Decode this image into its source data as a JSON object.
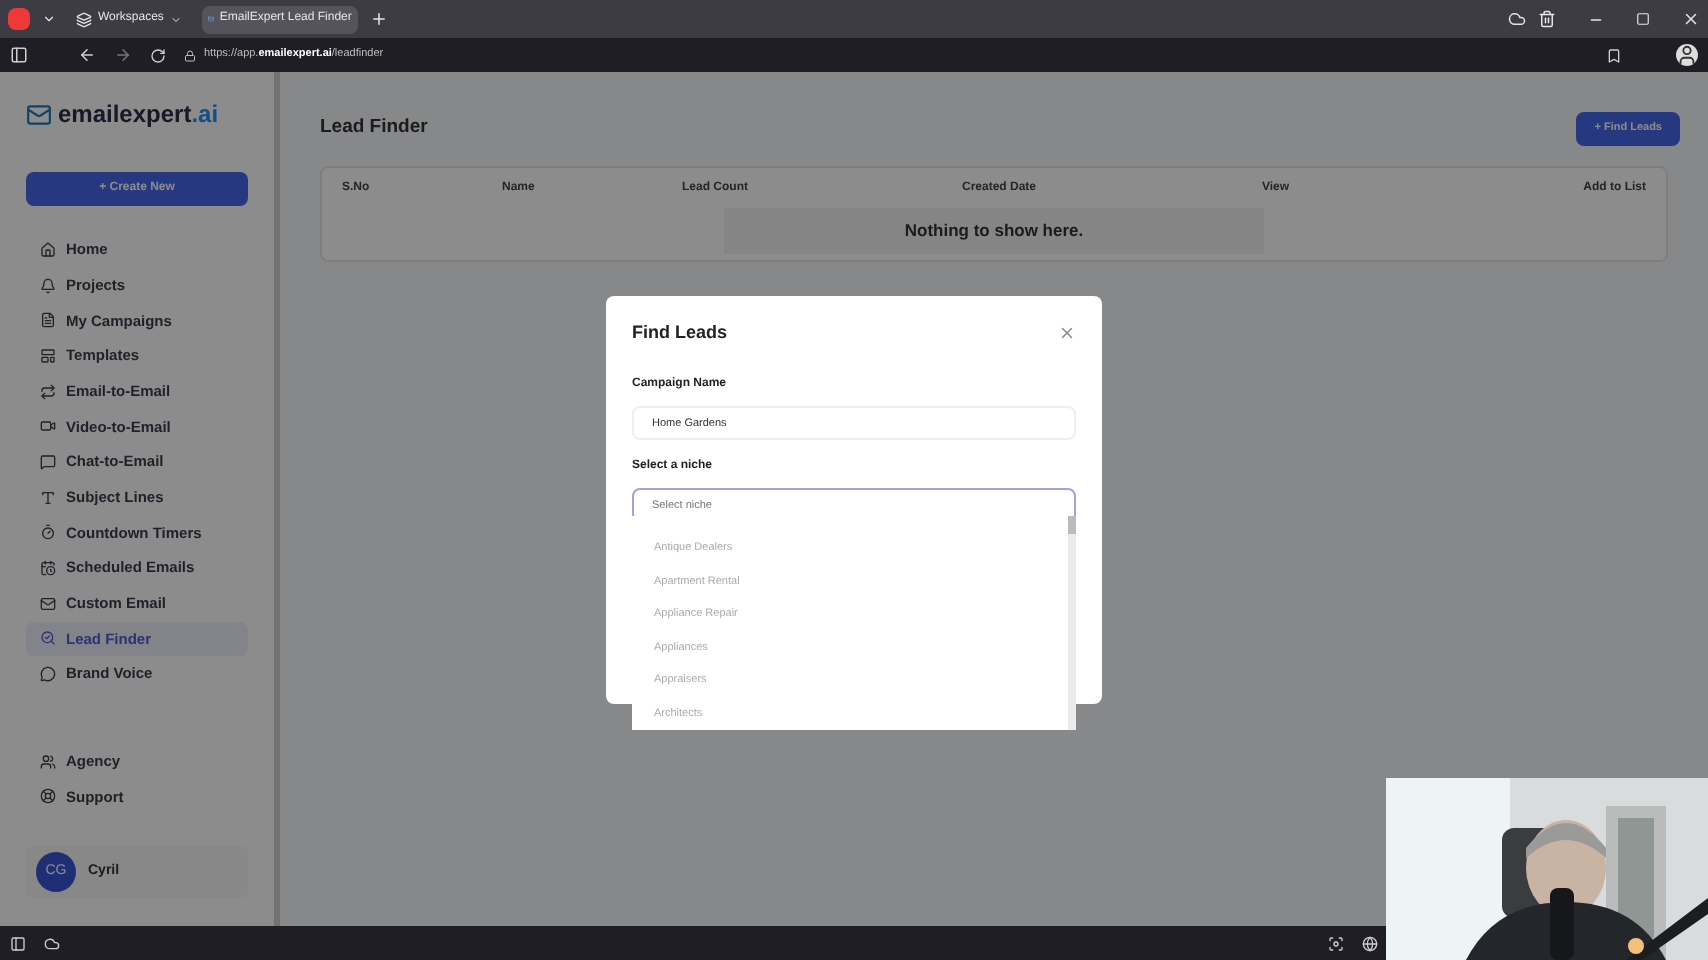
{
  "browser": {
    "workspaces": "Workspaces",
    "tab_title": "EmailExpert Lead Finder",
    "url_prefix": "https://app.",
    "url_domain": "emailexpert.ai",
    "url_path": "/leadfinder"
  },
  "sidebar": {
    "logo_main": "emailexpert",
    "logo_suffix": ".ai",
    "create_button": "+ Create New",
    "items": [
      {
        "label": "Home",
        "selected": false
      },
      {
        "label": "Projects",
        "selected": false
      },
      {
        "label": "My Campaigns",
        "selected": false
      },
      {
        "label": "Templates",
        "selected": false
      },
      {
        "label": "Email-to-Email",
        "selected": false
      },
      {
        "label": "Video-to-Email",
        "selected": false
      },
      {
        "label": "Chat-to-Email",
        "selected": false
      },
      {
        "label": "Subject Lines",
        "selected": false
      },
      {
        "label": "Countdown Timers",
        "selected": false
      },
      {
        "label": "Scheduled Emails",
        "selected": false
      },
      {
        "label": "Custom Email",
        "selected": false
      },
      {
        "label": "Lead Finder",
        "selected": true
      },
      {
        "label": "Brand Voice",
        "selected": false
      }
    ],
    "bottom_items": [
      {
        "label": "Agency",
        "selected": false
      },
      {
        "label": "Support",
        "selected": false
      }
    ],
    "user": {
      "initials": "CG",
      "name": "Cyril"
    }
  },
  "page": {
    "title": "Lead Finder",
    "find_button": "+ Find Leads",
    "table": {
      "columns": [
        "S.No",
        "Name",
        "Lead Count",
        "Created Date",
        "View",
        "Add to List"
      ],
      "empty_text": "Nothing to show here."
    }
  },
  "dialog": {
    "title": "Find Leads",
    "campaign_label": "Campaign Name",
    "campaign_value": "Home Gardens",
    "niche_label": "Select a niche",
    "niche_placeholder": "Select niche",
    "options": [
      "Antique Dealers",
      "Apartment Rental",
      "Appliance Repair",
      "Appliances",
      "Appraisers",
      "Architects"
    ]
  }
}
